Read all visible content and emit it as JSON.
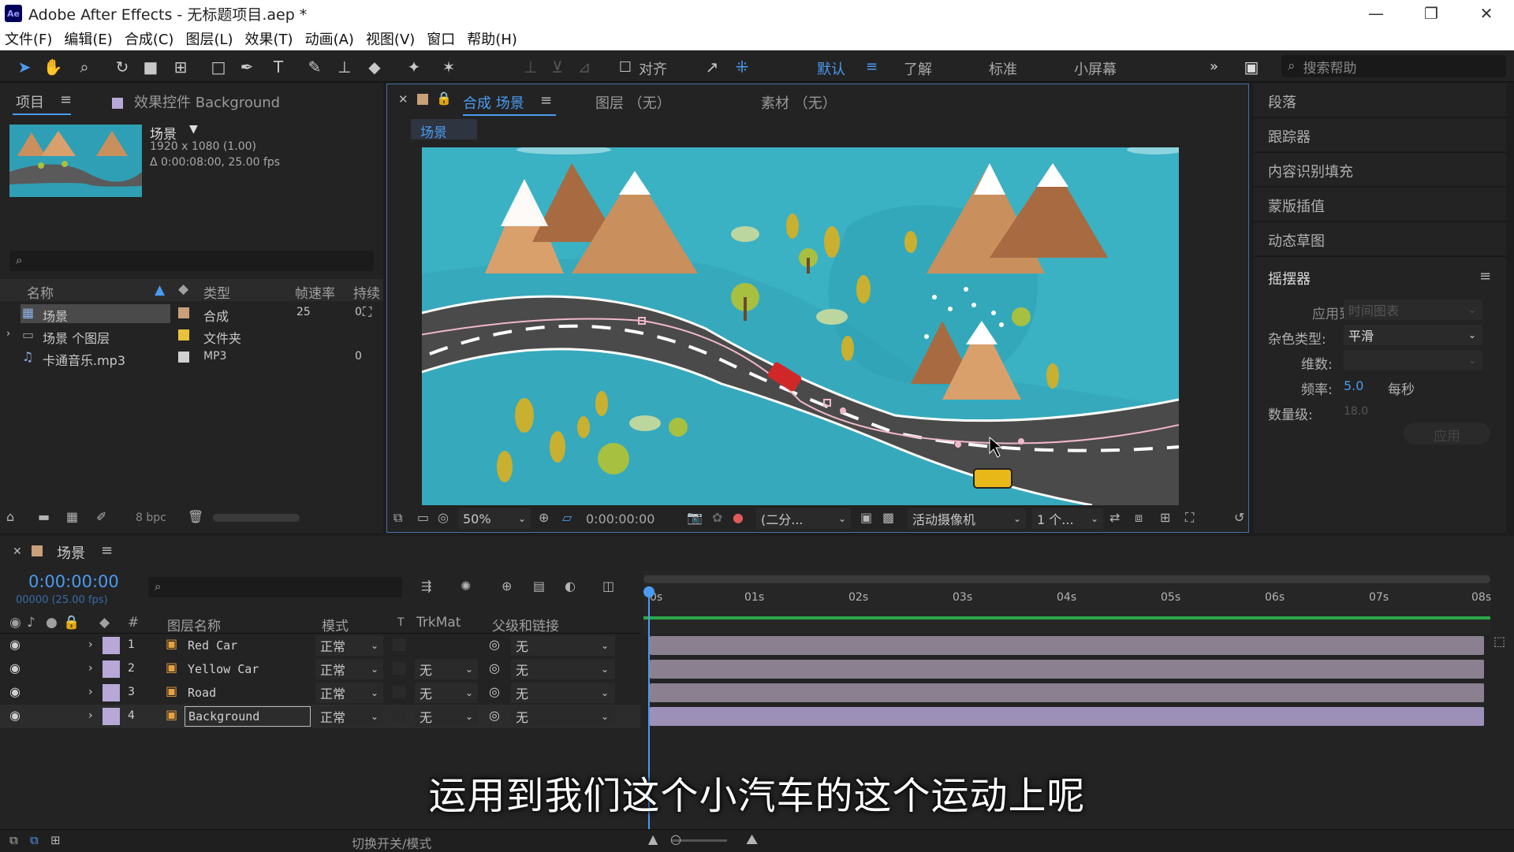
{
  "window": {
    "app_title": "Adobe After Effects - 无标题项目.aep *",
    "logo": "Ae"
  },
  "menu": [
    "文件(F)",
    "编辑(E)",
    "合成(C)",
    "图层(L)",
    "效果(T)",
    "动画(A)",
    "视图(V)",
    "窗口",
    "帮助(H)"
  ],
  "toolbar": {
    "align_label": "对齐",
    "workspaces": [
      "默认",
      "了解",
      "标准",
      "小屏幕"
    ],
    "help_placeholder": "搜索帮助"
  },
  "project": {
    "tab_label": "项目",
    "effects_tab": "效果控件 Background",
    "selected": {
      "name": "场景",
      "size": "1920 x 1080 (1.00)",
      "duration": "Δ 0:00:08:00, 25.00 fps"
    },
    "columns": [
      "名称",
      "类型",
      "帧速率",
      "持续"
    ],
    "items": [
      {
        "name": "场景",
        "type": "合成",
        "fps": "25",
        "extra": "0",
        "color": "#c9a07a"
      },
      {
        "name": "场景 个图层",
        "type": "文件夹",
        "fps": "",
        "extra": "",
        "color": "#e8c23a"
      },
      {
        "name": "卡通音乐.mp3",
        "type": "MP3",
        "fps": "",
        "extra": "0",
        "color": "#d0d0d0"
      }
    ],
    "bpc": "8 bpc"
  },
  "viewer": {
    "comp_tab": "合成 场景",
    "layer_tab": "图层 （无）",
    "footage_tab": "素材 （无）",
    "breadcrumb": "场景",
    "zoom": "50%",
    "timecode": "0:00:00:00",
    "resolution": "(二分...",
    "camera": "活动摄像机",
    "views": "1 个..."
  },
  "right_panels": {
    "items": [
      "段落",
      "跟踪器",
      "内容识别填充",
      "蒙版插值",
      "动态草图"
    ],
    "wiggler_title": "摇摆器",
    "apply_to_label": "应用到:",
    "apply_to_value": "时间图表",
    "noise_label": "杂色类型:",
    "noise_value": "平滑",
    "dimension_label": "维数:",
    "freq_label": "频率:",
    "freq_value": "5.0",
    "freq_unit": "每秒",
    "magnitude_label": "数量级:",
    "magnitude_value": "18.0",
    "apply_button": "应用"
  },
  "timeline": {
    "comp_name": "场景",
    "timecode": "0:00:00:00",
    "frames": "00000 (25.00 fps)",
    "columns": {
      "num": "#",
      "name": "图层名称",
      "mode": "模式",
      "t": "T",
      "trkmat": "TrkMat",
      "parent": "父级和链接"
    },
    "ruler": [
      "0s",
      "01s",
      "02s",
      "03s",
      "04s",
      "05s",
      "06s",
      "07s",
      "08s"
    ],
    "layers": [
      {
        "num": "1",
        "name": "Red Car",
        "mode": "正常",
        "trkmat": "",
        "parent": "无"
      },
      {
        "num": "2",
        "name": "Yellow Car",
        "mode": "正常",
        "trkmat": "无",
        "parent": "无"
      },
      {
        "num": "3",
        "name": "Road",
        "mode": "正常",
        "trkmat": "无",
        "parent": "无"
      },
      {
        "num": "4",
        "name": "Background",
        "mode": "正常",
        "trkmat": "无",
        "parent": "无"
      }
    ],
    "toggle_label": "切换开关/模式"
  },
  "subtitle": "运用到我们这个小汽车的这个运动上呢",
  "colors": {
    "accent": "#4a9bf0",
    "panel": "#232323",
    "layer_label": "#b7a8d8"
  }
}
